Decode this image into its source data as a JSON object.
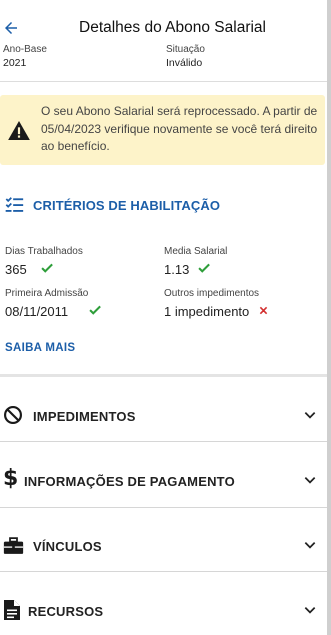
{
  "header": {
    "title": "Detalhes do Abono Salarial",
    "ano_base_label": "Ano-Base",
    "ano_base_value": "2021",
    "situacao_label": "Situação",
    "situacao_value": "Inválido"
  },
  "alert": {
    "icon": "warning-icon",
    "text": "O seu Abono Salarial será reprocessado. A partir de 05/04/2023 verifique novamente se você terá direito ao benefício."
  },
  "criterios": {
    "icon": "checklist-icon",
    "title": "CRITÉRIOS DE HABILITAÇÃO",
    "fields": [
      {
        "label": "Dias Trabalhados",
        "value": "365",
        "status": "ok"
      },
      {
        "label": "Media Salarial",
        "value": "1.13",
        "status": "ok"
      },
      {
        "label": "Primeira Admissão",
        "value": "08/11/2011",
        "status": "ok"
      },
      {
        "label": "Outros impedimentos",
        "value": "1 impedimento",
        "status": "fail"
      }
    ],
    "saiba_mais": "SAIBA MAIS"
  },
  "sections": [
    {
      "label": "IMPEDIMENTOS",
      "icon": "block-icon"
    },
    {
      "label": "INFORMAÇÕES DE PAGAMENTO",
      "icon": "dollar-icon"
    },
    {
      "label": "VÍNCULOS",
      "icon": "briefcase-icon"
    },
    {
      "label": "RECURSOS",
      "icon": "document-icon"
    }
  ],
  "colors": {
    "accent": "#1c5ea8",
    "check": "#2e9e3a",
    "cross": "#d32f2f",
    "alert_bg": "#fdf3c9"
  }
}
